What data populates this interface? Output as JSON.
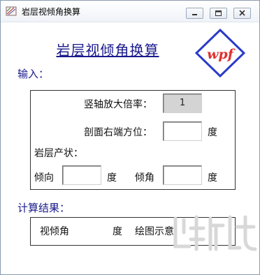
{
  "window": {
    "title": "岩层视倾角换算"
  },
  "header": {
    "title": "岩层视倾角换算",
    "logo_text": "wpf"
  },
  "input_section": {
    "label": "输入：",
    "magnification_label": "竖轴放大倍率：",
    "magnification_value": "1",
    "section_azimuth_label": "剖面右端方位：",
    "section_azimuth_value": "",
    "section_azimuth_unit": "度",
    "occurrence_label": "岩层产状：",
    "dip_direction_label": "倾向",
    "dip_direction_value": "",
    "dip_direction_unit": "度",
    "dip_angle_label": "倾角",
    "dip_angle_value": "",
    "dip_angle_unit": "度"
  },
  "result_section": {
    "label": "计算结果：",
    "apparent_dip_label": "视倾角",
    "apparent_dip_value": "",
    "apparent_dip_unit": "度",
    "diagram_link": "绘图示意"
  },
  "colors": {
    "heading": "#1a1a8c",
    "logo_blue": "#2a3cc8",
    "logo_red": "#e03030",
    "logo_green": "#2aa02a",
    "readonly_field": "#d4d4d4"
  }
}
